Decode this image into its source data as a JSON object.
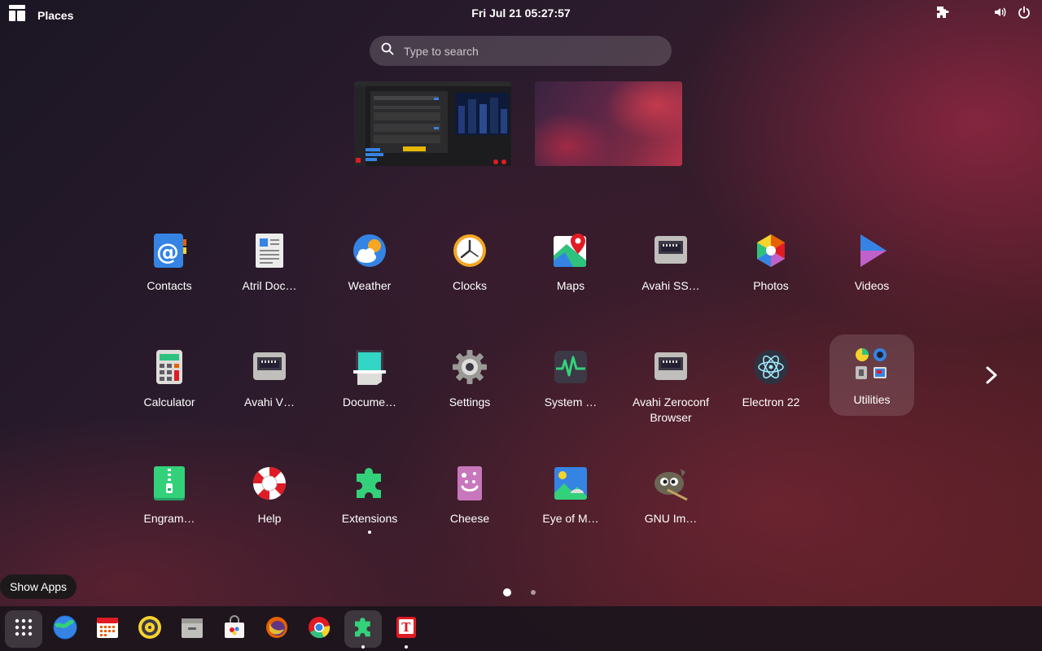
{
  "topbar": {
    "activities_icon": "grid-layout-icon",
    "places_label": "Places",
    "clock": "Fri Jul 21  05:27:57",
    "extension_icon": "puzzle-icon",
    "volume_icon": "speaker-icon",
    "power_icon": "power-icon"
  },
  "search": {
    "placeholder": "Type to search"
  },
  "apps": [
    {
      "label": "Contacts",
      "icon": "contacts-icon"
    },
    {
      "label": "Atril Doc…",
      "icon": "atril-document-viewer-icon"
    },
    {
      "label": "Weather",
      "icon": "weather-icon"
    },
    {
      "label": "Clocks",
      "icon": "clocks-icon"
    },
    {
      "label": "Maps",
      "icon": "maps-icon"
    },
    {
      "label": "Avahi SS…",
      "icon": "avahi-ssh-icon"
    },
    {
      "label": "Photos",
      "icon": "photos-icon"
    },
    {
      "label": "Videos",
      "icon": "videos-icon"
    },
    {
      "label": "Calculator",
      "icon": "calculator-icon"
    },
    {
      "label": "Avahi V…",
      "icon": "avahi-vnc-icon"
    },
    {
      "label": "Docume…",
      "icon": "document-scanner-icon"
    },
    {
      "label": "Settings",
      "icon": "settings-gear-icon"
    },
    {
      "label": "System …",
      "icon": "system-monitor-icon"
    },
    {
      "label": "Avahi Zeroconf Browser",
      "icon": "avahi-zeroconf-icon"
    },
    {
      "label": "Electron 22",
      "icon": "electron-icon"
    },
    {
      "label": "Utilities",
      "icon": "utilities-folder-icon"
    },
    {
      "label": "Engram…",
      "icon": "engrampa-icon"
    },
    {
      "label": "Help",
      "icon": "help-lifebuoy-icon"
    },
    {
      "label": "Extensions",
      "icon": "extensions-puzzle-icon"
    },
    {
      "label": "Cheese",
      "icon": "cheese-icon"
    },
    {
      "label": "Eye of M…",
      "icon": "eye-of-mate-icon"
    },
    {
      "label": "GNU Im…",
      "icon": "gimp-icon"
    }
  ],
  "pager": {
    "pages": 2,
    "current": 1
  },
  "tooltip": "Show Apps",
  "dash": [
    {
      "icon": "show-apps-icon"
    },
    {
      "icon": "browser-globe-icon"
    },
    {
      "icon": "calendar-icon"
    },
    {
      "icon": "rhythmbox-icon"
    },
    {
      "icon": "file-manager-icon"
    },
    {
      "icon": "software-store-icon"
    },
    {
      "icon": "firefox-icon"
    },
    {
      "icon": "chrome-icon"
    },
    {
      "icon": "extensions-puzzle-icon"
    },
    {
      "icon": "text-editor-icon"
    }
  ],
  "colors": {
    "accent_blue": "#3584e4",
    "topbar_text": "#ffffff",
    "dash_bg": "#19141c"
  }
}
